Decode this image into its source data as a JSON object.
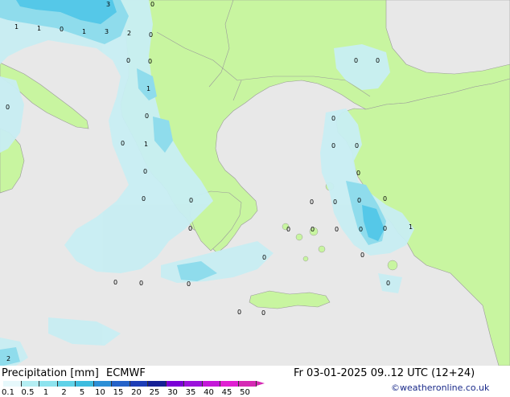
{
  "legend": {
    "title": "Precipitation [mm]",
    "model": "ECMWF",
    "ticks": [
      "0.1",
      "0.5",
      "1",
      "2",
      "5",
      "10",
      "15",
      "20",
      "25",
      "30",
      "35",
      "40",
      "45",
      "50"
    ],
    "colors": [
      "#e6f8fb",
      "#b4eef3",
      "#8ee3ee",
      "#5fd2e8",
      "#3dbcdf",
      "#2c8fd6",
      "#2563c8",
      "#1d3db6",
      "#152095",
      "#7a00d6",
      "#9b12db",
      "#c418d8",
      "#e020d2",
      "#d52ab4"
    ]
  },
  "valid_time": "Fr 03-01-2025 09..12 UTC (12+24)",
  "credit": "©weatheronline.co.uk",
  "map_colors": {
    "sea": "#e8e8e8",
    "land": "#c8f5a0",
    "border": "#9a9a9a",
    "precip_light": "#c8eef3",
    "precip_mid": "#8fdcec",
    "precip_strong": "#55c8e8"
  },
  "labels": [
    "3",
    "0",
    "1",
    "1",
    "0",
    "1",
    "3",
    "2",
    "0",
    "0",
    "0",
    "1",
    "0",
    "0",
    "1",
    "0",
    "0",
    "0",
    "0",
    "0",
    "0",
    "0",
    "0",
    "0",
    "0",
    "0",
    "0",
    "0",
    "0",
    "0",
    "0",
    "0",
    "0",
    "0",
    "0",
    "0",
    "0",
    "1",
    "0",
    "0",
    "0",
    "0",
    "0",
    "2",
    "0"
  ]
}
